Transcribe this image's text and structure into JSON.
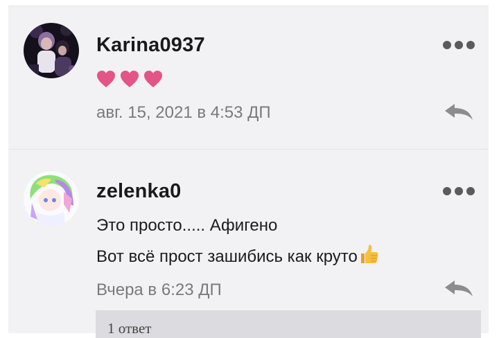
{
  "comments": [
    {
      "username": "Karina0937",
      "avatar_icon": "user-avatar-photo",
      "body_hearts": 3,
      "heart_color": "#e25586",
      "timestamp": "авг. 15, 2021 в 4:53 ДП"
    },
    {
      "username": "zelenka0",
      "avatar_icon": "anime-character-avatar",
      "body_lines": [
        "Это просто..... Афигено",
        "Вот всё прост зашибись как круто"
      ],
      "emoji": "thumbs-up-emoji",
      "timestamp": "Вчера в 6:23 ДП",
      "replies_label": "1 ответ"
    }
  ],
  "colors": {
    "card_background": "#f2f1f3",
    "timestamp": "#7a7a7a",
    "icon": "#5b5b5b",
    "replies_bar": "#dcdbdf"
  }
}
